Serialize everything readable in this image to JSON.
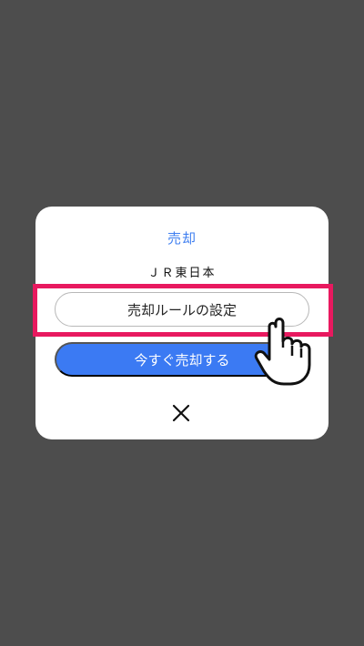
{
  "modal": {
    "title": "売却",
    "stock_name": "ＪＲ東日本",
    "rule_button_label": "売却ルールの設定",
    "sell_now_button_label": "今すぐ売却する",
    "close_icon": "close-icon"
  },
  "colors": {
    "overlay_background": "#4d4d4d",
    "accent_blue": "#3b7af3",
    "title_blue": "#3f7ff0",
    "highlight_pink": "#e8195f"
  },
  "icons": {
    "pointer": "hand-pointer-icon"
  }
}
